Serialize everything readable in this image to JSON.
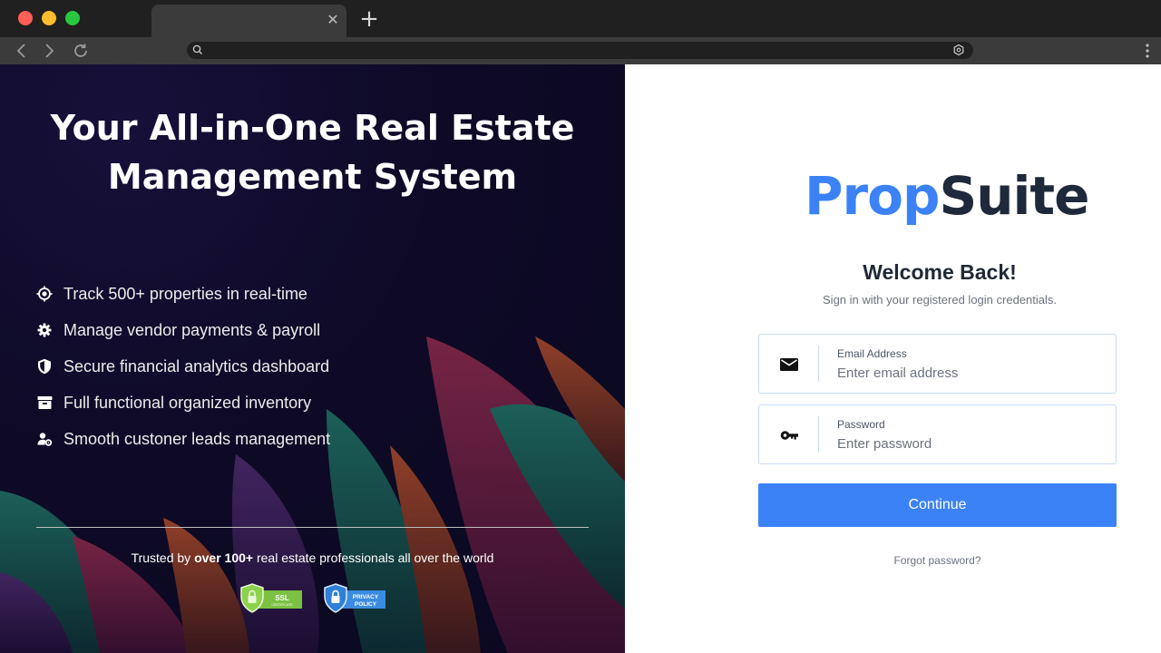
{
  "browser": {
    "tab_close": "✕",
    "new_tab": "+"
  },
  "hero": {
    "title_line1": "Your All-in-One Real Estate",
    "title_line2": "Management System",
    "features": [
      {
        "icon": "target-icon",
        "label": "Track 500+ properties in real-time"
      },
      {
        "icon": "gear-icon",
        "label": "Manage vendor payments & payroll"
      },
      {
        "icon": "shield-icon",
        "label": "Secure financial analytics dashboard"
      },
      {
        "icon": "archive-icon",
        "label": "Full functional organized inventory"
      },
      {
        "icon": "user-settings-icon",
        "label": "Smooth custoner leads management"
      }
    ],
    "trusted_prefix": "Trusted by",
    "trusted_bold": "over 100+",
    "trusted_suffix": "real estate professionals all over the world",
    "badge_ssl": "SSL",
    "badge_ssl_sub": "CERTIFICATE",
    "badge_privacy_1": "PRIVACY",
    "badge_privacy_2": "POLICY"
  },
  "login": {
    "logo_part1": "Prop",
    "logo_part2": "Suite",
    "welcome_title": "Welcome Back!",
    "welcome_subtitle": "Sign in with your registered login credentials.",
    "email_label": "Email Address",
    "email_placeholder": "Enter email address",
    "password_label": "Password",
    "password_placeholder": "Enter password",
    "continue_label": "Continue",
    "forgot_label": "Forgot password?"
  },
  "colors": {
    "accent": "#3b82f6",
    "logo_dark": "#1e293b",
    "hero_bg": "#0e0a26"
  }
}
